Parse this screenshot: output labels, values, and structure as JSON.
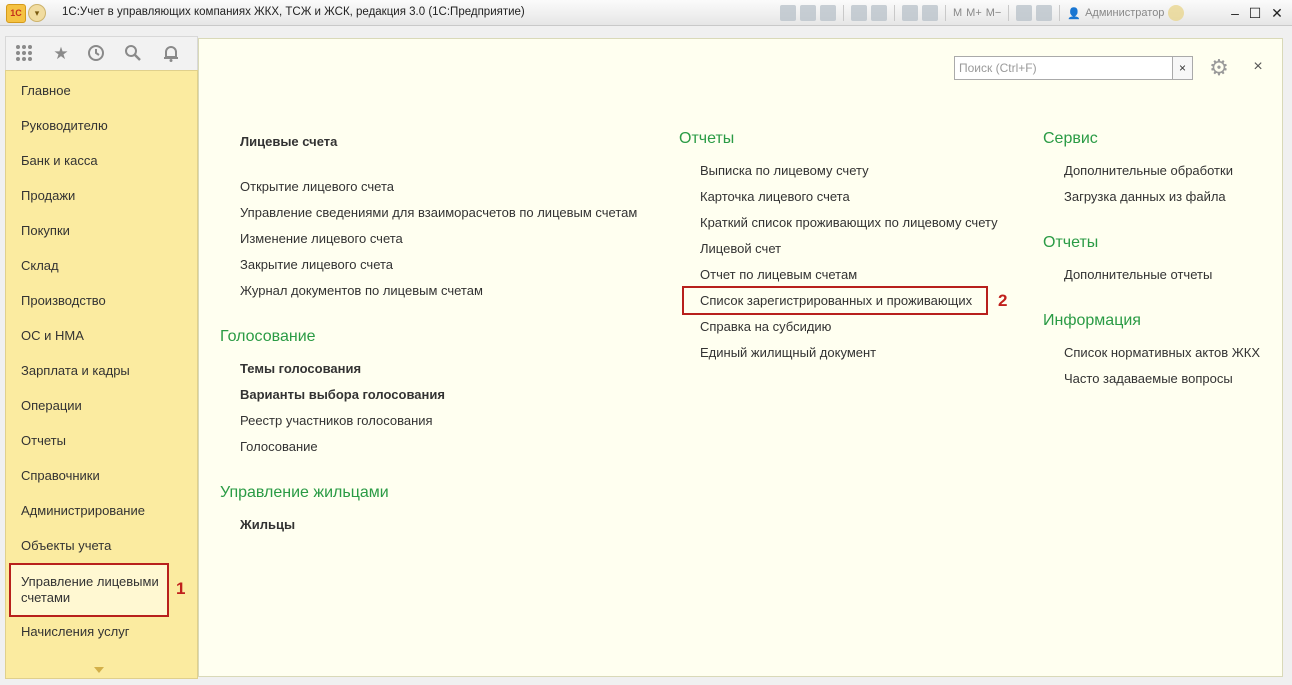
{
  "titlebar": {
    "logo": "1С",
    "menu_glyph": "▾",
    "title": "1С:Учет в управляющих компаниях ЖКХ, ТСЖ и ЖСК, редакция 3.0  (1С:Предприятие)",
    "m_buttons": [
      "M",
      "M+",
      "M−"
    ],
    "user": "Администратор",
    "user_glyph": "👤",
    "minimize": "–",
    "maximize": "☐",
    "close": "✕"
  },
  "sidebar": {
    "items": [
      "Главное",
      "Руководителю",
      "Банк и касса",
      "Продажи",
      "Покупки",
      "Склад",
      "Производство",
      "ОС и НМА",
      "Зарплата и кадры",
      "Операции",
      "Отчеты",
      "Справочники",
      "Администрирование",
      "Объекты учета"
    ],
    "selected_line1": "Управление лицевыми",
    "selected_line2": "счетами",
    "after": "Начисления услуг",
    "marker": "1"
  },
  "search": {
    "placeholder": "Поиск (Ctrl+F)",
    "clear": "×"
  },
  "main": {
    "close": "×",
    "col1": {
      "heading": "Лицевые счета",
      "links": [
        "Открытие лицевого счета",
        "Управление сведениями для взаиморасчетов по лицевым счетам",
        "Изменение лицевого счета",
        "Закрытие лицевого счета",
        "Журнал документов по лицевым счетам"
      ],
      "voting_title": "Голосование",
      "voting_bold": [
        "Темы голосования",
        "Варианты выбора голосования"
      ],
      "voting_links": [
        "Реестр участников голосования",
        "Голосование"
      ],
      "tenants_title": "Управление жильцами",
      "tenants_bold": "Жильцы"
    },
    "col2": {
      "title": "Отчеты",
      "links": [
        "Выписка по лицевому счету",
        "Карточка лицевого счета",
        "Краткий список проживающих по лицевому счету",
        "Лицевой счет",
        "Отчет по лицевым счетам",
        "Список зарегистрированных и проживающих",
        "Справка на субсидию",
        "Единый жилищный документ"
      ],
      "marker": "2"
    },
    "col3": {
      "service_title": "Сервис",
      "service_links": [
        "Дополнительные обработки",
        "Загрузка данных из файла"
      ],
      "reports_title": "Отчеты",
      "reports_links": [
        "Дополнительные отчеты"
      ],
      "info_title": "Информация",
      "info_links": [
        "Список нормативных актов ЖКХ",
        "Часто задаваемые вопросы"
      ]
    }
  },
  "colors": {
    "section_green": "#2a9b45",
    "sidebar_yellow": "#fbeba0",
    "highlight_red": "#b8201c",
    "content_bg": "#fffff0"
  }
}
